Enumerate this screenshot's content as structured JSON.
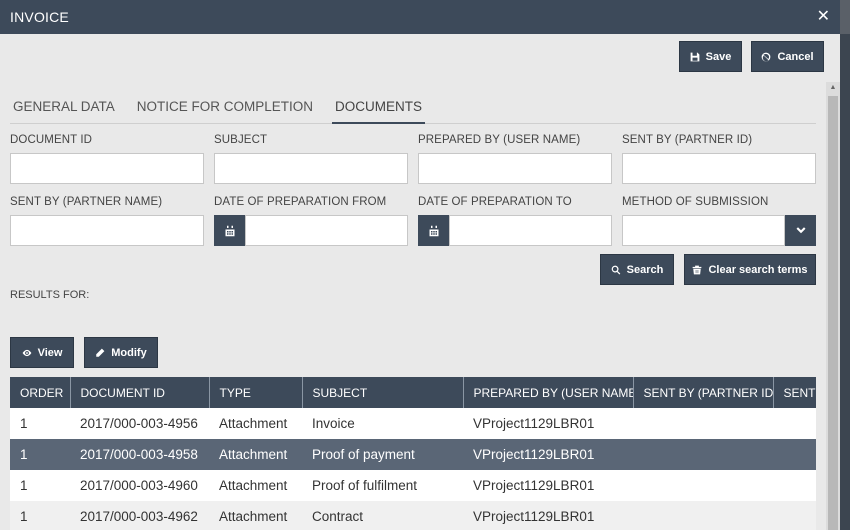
{
  "window": {
    "title": "INVOICE"
  },
  "toolbar": {
    "save_label": "Save",
    "cancel_label": "Cancel"
  },
  "tabs": [
    {
      "label": "GENERAL DATA",
      "active": false
    },
    {
      "label": "NOTICE FOR COMPLETION",
      "active": false
    },
    {
      "label": "DOCUMENTS",
      "active": true
    }
  ],
  "filters": {
    "document_id": {
      "label": "DOCUMENT ID",
      "value": ""
    },
    "subject": {
      "label": "SUBJECT",
      "value": ""
    },
    "prepared_by": {
      "label": "PREPARED BY (USER NAME)",
      "value": ""
    },
    "sent_by_partner_id": {
      "label": "SENT BY (PARTNER ID)",
      "value": ""
    },
    "sent_by_partner_name": {
      "label": "SENT BY (PARTNER NAME)",
      "value": ""
    },
    "date_from": {
      "label": "DATE OF PREPARATION FROM",
      "value": ""
    },
    "date_to": {
      "label": "DATE OF PREPARATION TO",
      "value": ""
    },
    "method": {
      "label": "METHOD OF SUBMISSION",
      "value": ""
    }
  },
  "search": {
    "search_label": "Search",
    "clear_label": "Clear search terms"
  },
  "results": {
    "label": "RESULTS FOR:"
  },
  "actions": {
    "view_label": "View",
    "modify_label": "Modify"
  },
  "table": {
    "columns": [
      "ORDER",
      "DOCUMENT ID",
      "TYPE",
      "SUBJECT",
      "PREPARED BY (USER NAME)",
      "SENT BY (PARTNER ID)",
      "SENT BY"
    ],
    "rows": [
      [
        "1",
        "2017/000-003-4956",
        "Attachment",
        "Invoice",
        "VProject1129LBR01",
        "",
        ""
      ],
      [
        "1",
        "2017/000-003-4958",
        "Attachment",
        "Proof of payment",
        "VProject1129LBR01",
        "",
        ""
      ],
      [
        "1",
        "2017/000-003-4960",
        "Attachment",
        "Proof of fulfilment",
        "VProject1129LBR01",
        "",
        ""
      ],
      [
        "1",
        "2017/000-003-4962",
        "Attachment",
        "Contract",
        "VProject1129LBR01",
        "",
        ""
      ]
    ],
    "selected_row": 1
  },
  "colors": {
    "primary": "#3d4a5a",
    "selected_row": "#5a6676",
    "background": "#e9e9e9"
  }
}
